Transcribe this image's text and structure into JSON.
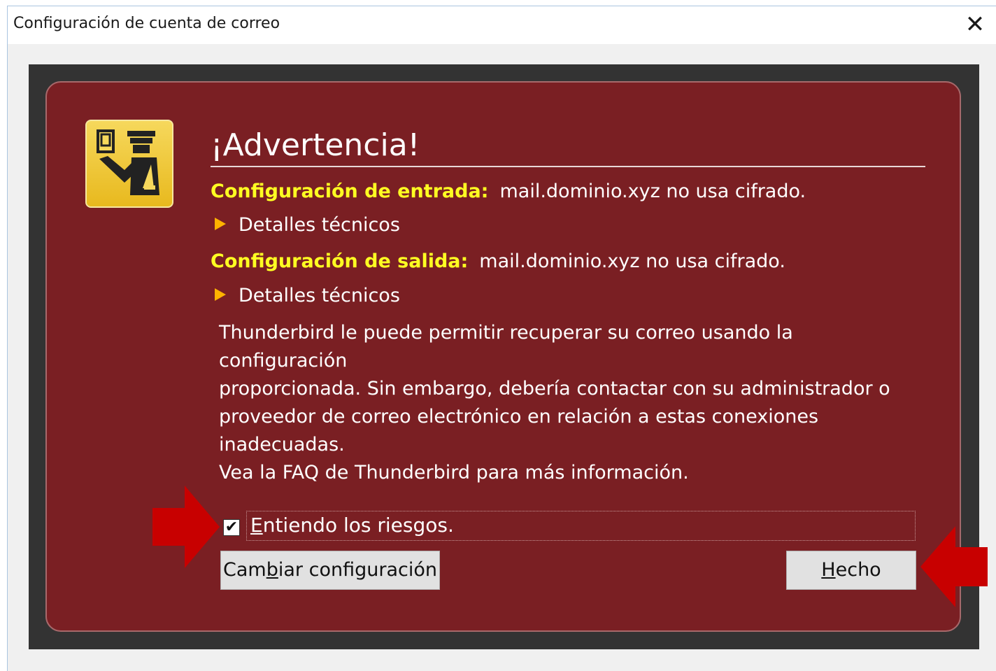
{
  "window": {
    "title": "Configuración de cuenta de correo",
    "close_glyph": "✕"
  },
  "warning": {
    "icon": "security-officer-icon",
    "heading": "¡Advertencia!",
    "incoming": {
      "label": "Configuración de entrada:",
      "message": "mail.dominio.xyz no usa cifrado.",
      "details": "Detalles técnicos"
    },
    "outgoing": {
      "label": "Configuración de salida:",
      "message": "mail.dominio.xyz no usa cifrado.",
      "details": "Detalles técnicos"
    },
    "paragraph_lines": [
      "Thunderbird le puede permitir recuperar su correo usando la configuración",
      "proporcionada. Sin embargo, debería contactar con su administrador o",
      "proveedor de correo electrónico en relación a estas conexiones inadecuadas.",
      "Vea la FAQ de Thunderbird para más información."
    ]
  },
  "risk_checkbox": {
    "checked": true,
    "check_glyph": "✔",
    "label": "Entiendo los riesgos."
  },
  "buttons": {
    "change_config": "Cambiar configuración",
    "done": "Hecho"
  },
  "colors": {
    "panel_bg": "#7a1f23",
    "label_yellow": "#ffff22",
    "arrow_red": "#c80000",
    "badge_yellow": "#f2cc3a"
  }
}
